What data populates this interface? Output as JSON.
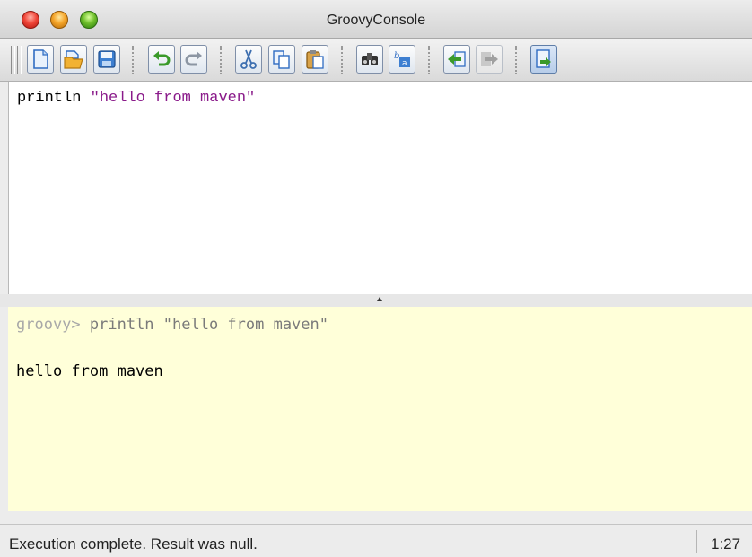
{
  "window": {
    "title": "GroovyConsole"
  },
  "toolbar": {
    "buttons": [
      {
        "name": "new-file-button",
        "icon": "new-document-icon"
      },
      {
        "name": "open-file-button",
        "icon": "open-folder-icon"
      },
      {
        "name": "save-button",
        "icon": "save-disk-icon"
      },
      {
        "name": "undo-button",
        "icon": "undo-icon"
      },
      {
        "name": "redo-button",
        "icon": "redo-icon"
      },
      {
        "name": "cut-button",
        "icon": "scissors-icon"
      },
      {
        "name": "copy-button",
        "icon": "copy-icon"
      },
      {
        "name": "paste-button",
        "icon": "paste-icon"
      },
      {
        "name": "find-button",
        "icon": "binoculars-icon"
      },
      {
        "name": "replace-button",
        "icon": "replace-icon"
      },
      {
        "name": "history-prev-button",
        "icon": "history-back-icon"
      },
      {
        "name": "history-next-button",
        "icon": "history-forward-icon"
      },
      {
        "name": "run-script-button",
        "icon": "run-script-icon"
      }
    ]
  },
  "editor": {
    "code_keyword": "println",
    "code_string": "\"hello from maven\""
  },
  "output": {
    "prompt": "groovy>",
    "command": " println \"hello from maven\"",
    "result": "hello from maven"
  },
  "status": {
    "message": "Execution complete. Result was null.",
    "cursor_position": "1:27"
  },
  "colors": {
    "output_background": "#ffffd9",
    "string_literal": "#8a1a8a",
    "toolbar_icon_blue": "#3d7fd1"
  }
}
